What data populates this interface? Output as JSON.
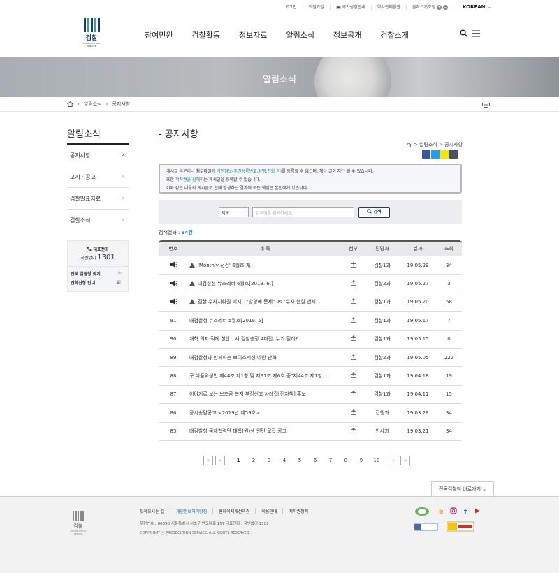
{
  "util_bar": {
    "items": [
      "로그인",
      "회원가입",
      "국가상징안내",
      "역사관체험관",
      "글자크기조정"
    ],
    "lang": "KOREAN"
  },
  "logo": {
    "name": "검찰",
    "sub": "PROSECUTION SERVICE"
  },
  "gnb": [
    "참여민원",
    "검찰활동",
    "정보자료",
    "알림소식",
    "정보공개",
    "검찰소개"
  ],
  "banner": {
    "title": "알림소식"
  },
  "breadcrumb": [
    "알림소식",
    "공지사항"
  ],
  "sidebar": {
    "title": "알림소식",
    "items": [
      {
        "label": "공지사항",
        "active": true
      },
      {
        "label": "고시 · 공고",
        "active": false
      },
      {
        "label": "검찰발표자료",
        "active": false
      },
      {
        "label": "검찰소식",
        "active": false
      }
    ],
    "call": {
      "label": "대표전화",
      "prefix": "국번없이",
      "number": "1301"
    },
    "links": [
      "전국 검찰청 찾기",
      "견학신청 안내"
    ]
  },
  "content": {
    "title": "- 공지사항",
    "path": "> 알림소식 > 공지사항",
    "notice": {
      "line1_a": "게시글 본문이나 첨부파일에 ",
      "line1_hl": "개인정보(주민등록번호,성명,전화 등)",
      "line1_b": "를 등록할 수 없으며, 해당 글이 차단 될 수 있습니다.",
      "line2_a": "또한 ",
      "line2_hl": "저작권을 침해",
      "line2_b": "하는 게시글을 등록할 수 없습니다.",
      "line3": "이와 같은 내용의 게시글로 인해 발생하는 결과에 모든 책임은 본인에게 있습니다."
    },
    "search": {
      "select": "제목",
      "placeholder": "검색어를 입력하세요.",
      "button": "검색"
    },
    "result": {
      "label": "검색결과 : ",
      "count": "94건"
    },
    "table": {
      "headers": [
        "번호",
        "제 목",
        "첨부",
        "담당과",
        "날짜",
        "조회"
      ],
      "rows": [
        {
          "num": "",
          "notice": true,
          "title": "'Monthly 정검' 6월호 게시",
          "dept": "검찰1과",
          "date": "19.05.29",
          "views": "34"
        },
        {
          "num": "",
          "notice": true,
          "title": "대검찰청 뉴스레터 6월호[2019. 6.]",
          "dept": "검찰2과",
          "date": "19.05.27",
          "views": "3"
        },
        {
          "num": "",
          "notice": true,
          "title": "검찰 수사지휘권 폐지…\"방향에 문제\" vs \"수사 현실 법제...",
          "dept": "검찰1과",
          "date": "19.05.20",
          "views": "58"
        },
        {
          "num": "91",
          "notice": false,
          "title": "대검찰청 뉴스레터 5월호[2019. 5]",
          "dept": "검찰1과",
          "date": "19.05.17",
          "views": "7"
        },
        {
          "num": "90",
          "notice": false,
          "title": "개혁 의지·적폐 청산…새 검찰총장 4파전, 누가 될까?",
          "dept": "검찰1과",
          "date": "19.05.15",
          "views": "0"
        },
        {
          "num": "89",
          "notice": false,
          "title": "대검찰청과 함께하는 보이스피싱 예방 만화",
          "dept": "검찰2과",
          "date": "19.05.05",
          "views": "222"
        },
        {
          "num": "88",
          "notice": false,
          "title": "구 식품위생법 제44조 제1항 및 제97조 제6호 중\"제44조 제1항...",
          "dept": "검찰1과",
          "date": "19.04.18",
          "views": "19"
        },
        {
          "num": "87",
          "notice": false,
          "title": "이야기로 보는 보조금 복지 부정신고 사례집[전자책] 홍보",
          "dept": "검찰1과",
          "date": "19.04.11",
          "views": "15"
        },
        {
          "num": "86",
          "notice": false,
          "title": "공시송달공고 <2019년 제59호>",
          "dept": "집행과",
          "date": "19.03.28",
          "views": "34"
        },
        {
          "num": "85",
          "notice": false,
          "title": "대검찰청 국제협력단 대학(원)생 인턴 모집 공고",
          "dept": "인사과",
          "date": "19.03.21",
          "views": "34"
        }
      ]
    },
    "pager": {
      "pages": [
        "1",
        "2",
        "3",
        "4",
        "5",
        "6",
        "7",
        "8",
        "9",
        "10"
      ],
      "current": "1"
    }
  },
  "footer": {
    "quick": "전국검찰청 바로가기",
    "links": [
      "찾아오시는 길",
      "개인정보처리방침",
      "홈페이지개선의견",
      "이용안내",
      "저작권정책"
    ],
    "address": "우편번호 : 06590 서울특별시 서초구 반포대로 157    대표전화 : 국번없이 1301",
    "copyright": "COPYRIGHT ⓒ PROSECUTION SERVICE. ALL RIGHTS RESERVED."
  },
  "colors": {
    "brand": "#1d3a6e",
    "accent": "#1c7fa6",
    "banner": "#a8aeb3"
  }
}
